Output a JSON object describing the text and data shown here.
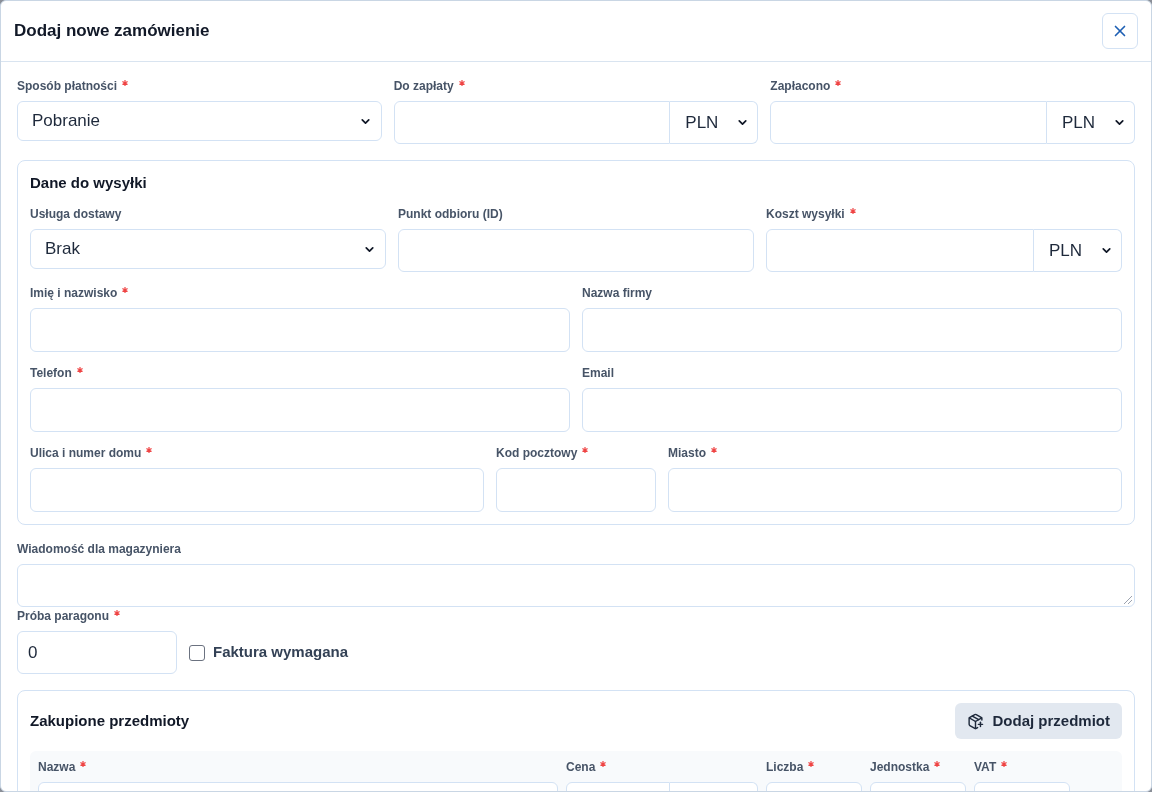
{
  "dialog": {
    "title": "Dodaj nowe zamówienie"
  },
  "payment_fields": [
    {
      "kind": "select",
      "label": "Sposób płatności",
      "required": true,
      "value": "Pobranie"
    },
    {
      "kind": "money",
      "label": "Do zapłaty",
      "required": true,
      "currency": "PLN"
    },
    {
      "kind": "money",
      "label": "Zapłacono",
      "required": true,
      "currency": "PLN"
    }
  ],
  "shipping": {
    "title": "Dane do wysyłki",
    "rows": [
      [
        {
          "kind": "select",
          "label": "Usługa dostawy",
          "required": false,
          "value": "Brak"
        },
        {
          "kind": "text",
          "label": "Punkt odbioru (ID)",
          "required": false
        },
        {
          "kind": "money",
          "label": "Koszt wysyłki",
          "required": true,
          "currency": "PLN"
        }
      ],
      [
        {
          "kind": "text",
          "label": "Imię i nazwisko",
          "required": true
        },
        {
          "kind": "text",
          "label": "Nazwa firmy",
          "required": false
        }
      ],
      [
        {
          "kind": "text",
          "label": "Telefon",
          "required": true
        },
        {
          "kind": "text",
          "label": "Email",
          "required": false
        }
      ],
      [
        {
          "kind": "text",
          "label": "Ulica i numer domu",
          "required": true
        },
        {
          "kind": "text",
          "label": "Kod pocztowy",
          "required": true
        },
        {
          "kind": "text",
          "label": "Miasto",
          "required": true
        }
      ]
    ]
  },
  "message": {
    "kind": "textarea",
    "label": "Wiadomość dla magazyniera",
    "required": false
  },
  "receipt": {
    "kind": "text",
    "label": "Próba paragonu",
    "required": true,
    "value": "0"
  },
  "invoice": {
    "label": "Faktura wymagana",
    "checked": false
  },
  "items": {
    "title": "Zakupione przedmioty",
    "add_button": "Dodaj przedmiot",
    "columns": [
      {
        "kind": "text",
        "label": "Nazwa",
        "required": true
      },
      {
        "kind": "money",
        "label": "Cena",
        "required": true
      },
      {
        "kind": "text",
        "label": "Liczba",
        "required": true
      },
      {
        "kind": "text",
        "label": "Jednostka",
        "required": true
      },
      {
        "kind": "text",
        "label": "VAT",
        "required": true
      }
    ]
  }
}
